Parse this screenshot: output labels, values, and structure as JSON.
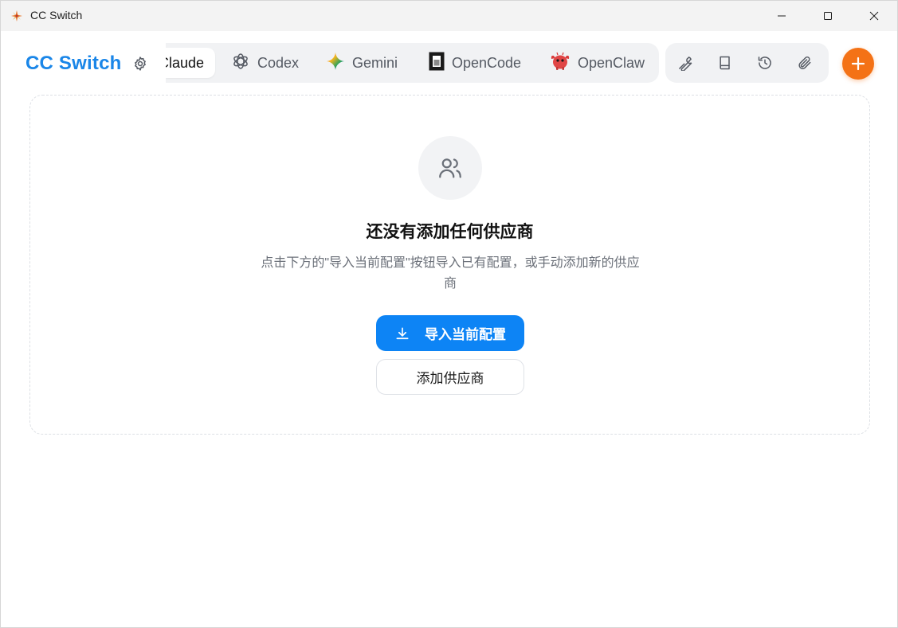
{
  "window": {
    "title": "CC Switch"
  },
  "header": {
    "brand": "CC Switch",
    "tabs": [
      {
        "label": "Claude",
        "icon": "claude-icon",
        "active": true
      },
      {
        "label": "Codex",
        "icon": "openai-icon",
        "active": false
      },
      {
        "label": "Gemini",
        "icon": "gemini-sparkle-icon",
        "active": false
      },
      {
        "label": "OpenCode",
        "icon": "opencode-icon",
        "active": false
      },
      {
        "label": "OpenClaw",
        "icon": "openclaw-icon",
        "active": false
      }
    ],
    "tools": [
      "wrench-icon",
      "book-icon",
      "history-icon",
      "paperclip-icon"
    ]
  },
  "empty_state": {
    "title": "还没有添加任何供应商",
    "description": "点击下方的\"导入当前配置\"按钮导入已有配置，或手动添加新的供应商",
    "import_label": "导入当前配置",
    "add_label": "添加供应商"
  },
  "colors": {
    "brand": "#1a86e8",
    "primary_button": "#0d84f5",
    "fab": "#f47216"
  }
}
